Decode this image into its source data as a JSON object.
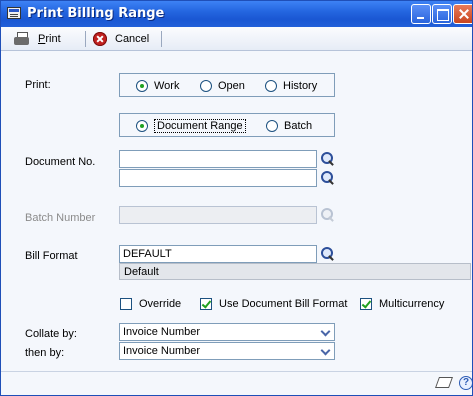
{
  "window": {
    "title": "Print Billing Range"
  },
  "toolbar": {
    "print_label": "Print",
    "print_accel": "P",
    "print_rest": "rint",
    "cancel_label": "Cancel"
  },
  "print_group": {
    "label": "Print:",
    "options": [
      "Work",
      "Open",
      "History"
    ],
    "selected": "Work"
  },
  "range_group": {
    "options": [
      "Document Range",
      "Batch"
    ],
    "selected": "Document Range"
  },
  "document_no": {
    "label": "Document No.",
    "from_value": "",
    "to_value": ""
  },
  "batch_number": {
    "label": "Batch Number",
    "value": "",
    "enabled": false
  },
  "bill_format": {
    "label": "Bill Format",
    "value": "DEFAULT",
    "description": "Default"
  },
  "checkboxes": [
    {
      "label": "Override",
      "checked": false
    },
    {
      "label": "Use Document Bill Format",
      "checked": true
    },
    {
      "label": "Multicurrency",
      "checked": true
    }
  ],
  "collate": {
    "collate_label": "Collate by:",
    "collate_value": "Invoice Number",
    "then_label": "then by:",
    "then_value": "Invoice Number"
  },
  "icons": [
    "printer-icon",
    "cancel-icon",
    "lookup-icon",
    "note-icon",
    "help-icon"
  ]
}
